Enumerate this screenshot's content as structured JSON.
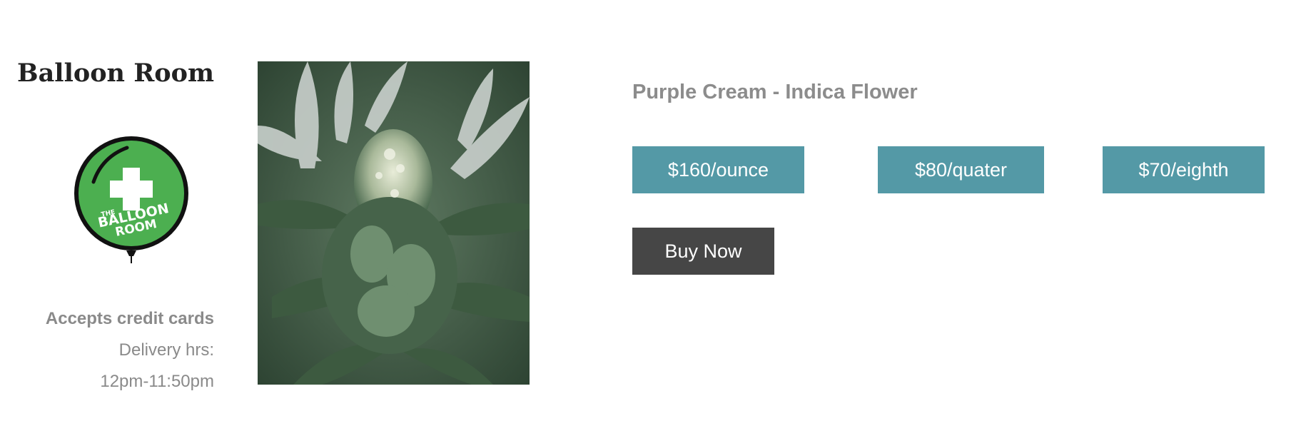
{
  "store": {
    "name": "Balloon Room",
    "logo": {
      "text_line_1": "THE",
      "text_line_2": "BALLOON",
      "text_line_3": "ROOM",
      "color": "#4caf50"
    },
    "accepts": "Accepts credit cards",
    "delivery_label": "Delivery hrs:",
    "delivery_hours": "12pm-11:50pm"
  },
  "product": {
    "title": "Purple Cream - Indica Flower",
    "image_icon": "cannabis-flower-photo"
  },
  "prices": [
    {
      "label": "$160/ounce"
    },
    {
      "label": "$80/quater"
    },
    {
      "label": "$70/eighth"
    }
  ],
  "actions": {
    "buy_label": "Buy Now"
  },
  "colors": {
    "price_button": "#5499a6",
    "buy_button": "#464646",
    "muted_text": "#8a8a8a"
  }
}
